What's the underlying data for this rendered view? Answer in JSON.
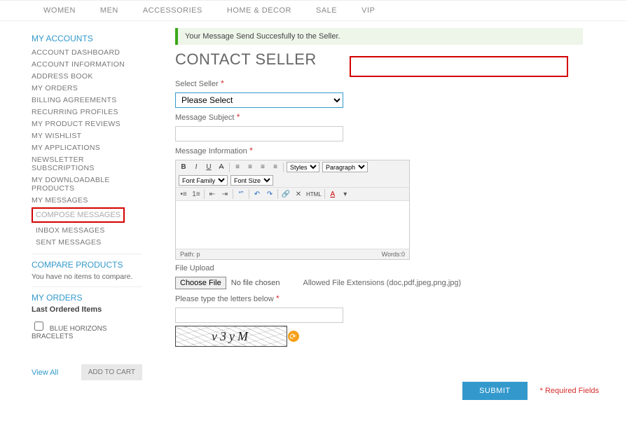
{
  "topnav": [
    "WOMEN",
    "MEN",
    "ACCESSORIES",
    "HOME & DECOR",
    "SALE",
    "VIP"
  ],
  "sidebar": {
    "title": "MY ACCOUNTS",
    "items": [
      "ACCOUNT DASHBOARD",
      "ACCOUNT INFORMATION",
      "ADDRESS BOOK",
      "MY ORDERS",
      "BILLING AGREEMENTS",
      "RECURRING PROFILES",
      "MY PRODUCT REVIEWS",
      "MY WISHLIST",
      "MY APPLICATIONS",
      "NEWSLETTER SUBSCRIPTIONS",
      "MY DOWNLOADABLE PRODUCTS",
      "MY MESSAGES"
    ],
    "highlighted": "COMPOSE MESSAGES",
    "subitems": [
      "INBOX MESSAGES",
      "SENT MESSAGES"
    ],
    "compare_title": "COMPARE PRODUCTS",
    "compare_note": "You have no items to compare.",
    "orders_title": "MY ORDERS",
    "last_ordered": "Last Ordered Items",
    "order_item": "BLUE HORIZONS BRACELETS",
    "view_all": "View All",
    "add_cart": "ADD TO CART"
  },
  "main": {
    "success": "Your Message Send Succesfully to the Seller.",
    "title": "CONTACT SELLER",
    "select_seller_label": "Select Seller",
    "select_seller_value": "Please Select",
    "subject_label": "Message Subject",
    "info_label": "Message Information",
    "editor": {
      "styles": "Styles",
      "paragraph": "Paragraph",
      "font_family": "Font Family",
      "font_size": "Font Size",
      "html": "HTML",
      "path": "Path: p",
      "words": "Words:0"
    },
    "file_label": "File Upload",
    "choose_file": "Choose File",
    "no_file": "No file chosen",
    "allowed": "Allowed File Extensions (doc,pdf,jpeg,png,jpg)",
    "letters_label": "Please type the letters below",
    "captcha_text": "v3yM",
    "submit": "SUBMIT",
    "required": "* Required Fields"
  }
}
